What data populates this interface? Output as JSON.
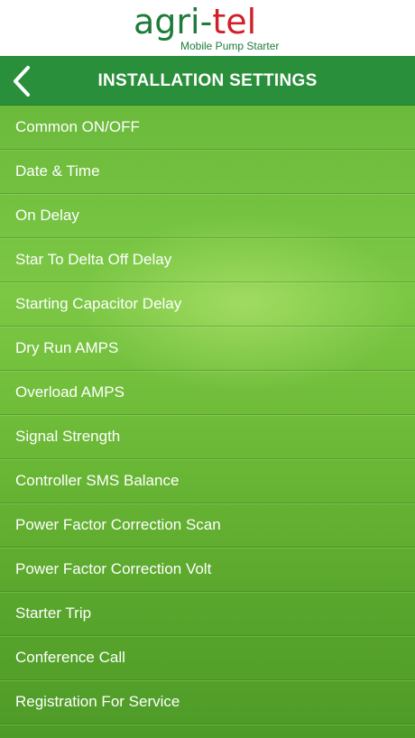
{
  "brand": {
    "name_part1": "agri",
    "name_sep": "-",
    "name_part2": "tel",
    "tagline": "Mobile Pump Starter",
    "colors": {
      "green": "#1e7b3a",
      "red": "#d11f2a"
    }
  },
  "header": {
    "title": "INSTALLATION SETTINGS",
    "back_icon": "chevron-left-icon",
    "color": "#2a8f3a"
  },
  "menu": {
    "items": [
      "Common ON/OFF",
      "Date & Time",
      "On Delay",
      "Star To Delta Off Delay",
      "Starting Capacitor Delay",
      "Dry Run AMPS",
      "Overload AMPS",
      "Signal Strength",
      "Controller SMS Balance",
      "Power Factor Correction Scan",
      "Power Factor Correction Volt",
      "Starter Trip",
      "Conference Call",
      "Registration For Service"
    ]
  }
}
